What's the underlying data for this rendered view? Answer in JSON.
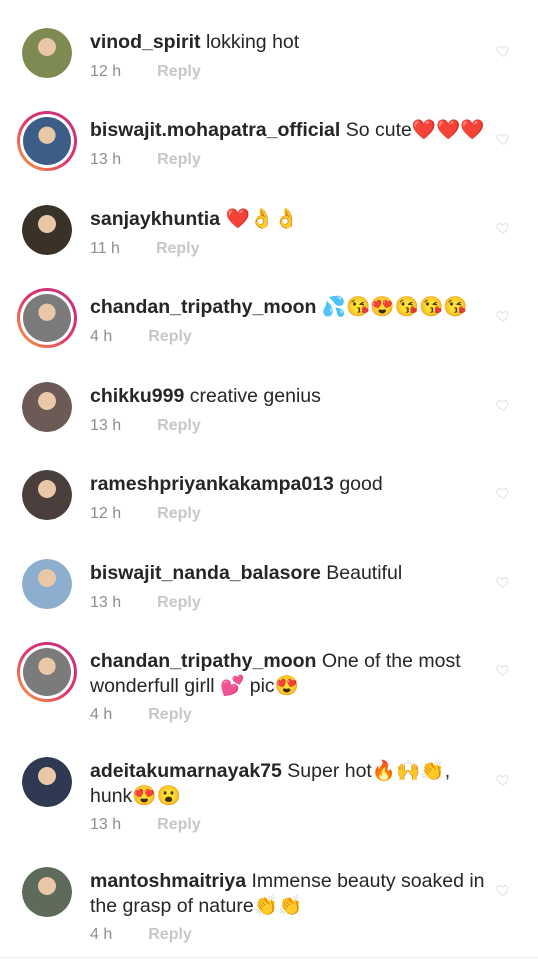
{
  "comments": [
    {
      "username": "vinod_spirit",
      "text": "lokking hot",
      "time": "12 h",
      "reply": "Reply",
      "avatar": "avatar-photo",
      "story_ring": false,
      "color": "#7d8a52"
    },
    {
      "username": "biswajit.mohapatra_official",
      "text": "So cute❤️❤️❤️",
      "time": "13 h",
      "reply": "Reply",
      "avatar": "avatar-photo",
      "story_ring": true,
      "color": "#3b5d86"
    },
    {
      "username": "sanjaykhuntia",
      "text": "❤️👌👌",
      "time": "11 h",
      "reply": "Reply",
      "avatar": "avatar-photo",
      "story_ring": false,
      "color": "#3a3228"
    },
    {
      "username": "chandan_tripathy_moon",
      "text": "💦😘😍😘😘😘",
      "time": "4 h",
      "reply": "Reply",
      "avatar": "avatar-photo",
      "story_ring": true,
      "color": "#7b7b7b"
    },
    {
      "username": "chikku999",
      "text": "creative genius",
      "time": "13 h",
      "reply": "Reply",
      "avatar": "avatar-photo",
      "story_ring": false,
      "color": "#6b5a55"
    },
    {
      "username": "rameshpriyankakampa013",
      "text": "good",
      "time": "12 h",
      "reply": "Reply",
      "avatar": "avatar-photo",
      "story_ring": false,
      "color": "#4a3f3c"
    },
    {
      "username": "biswajit_nanda_balasore",
      "text": "Beautiful",
      "time": "13 h",
      "reply": "Reply",
      "avatar": "avatar-photo",
      "story_ring": false,
      "color": "#8eaed0"
    },
    {
      "username": "chandan_tripathy_moon",
      "text": "One of the most wonderfull girll 💕 pic😍",
      "time": "4 h",
      "reply": "Reply",
      "avatar": "avatar-photo",
      "story_ring": true,
      "color": "#7b7b7b"
    },
    {
      "username": "adeitakumarnayak75",
      "text": "Super hot🔥🙌👏, hunk😍😮",
      "time": "13 h",
      "reply": "Reply",
      "avatar": "avatar-photo",
      "story_ring": false,
      "color": "#2f3a52"
    },
    {
      "username": "mantoshmaitriya",
      "text": "Immense beauty soaked in the grasp of nature👏👏",
      "time": "4 h",
      "reply": "Reply",
      "avatar": "avatar-photo",
      "story_ring": false,
      "color": "#5e6a5a"
    }
  ],
  "icons": {
    "like": "heart-outline-icon"
  }
}
